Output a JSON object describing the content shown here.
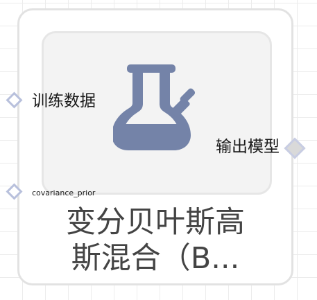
{
  "node": {
    "title_line1": "变分贝叶斯高",
    "title_line2": "斯混合（B...",
    "icon": "flask-icon",
    "inputs": [
      {
        "label": "训练数据"
      },
      {
        "label": "covariance_prior"
      }
    ],
    "outputs": [
      {
        "label": "输出模型"
      }
    ]
  },
  "colors": {
    "icon": "#7483a8",
    "port_border": "#b8c0dc",
    "node_border": "#e2e2e2",
    "icon_bg": "#f3f3f3",
    "title_text": "#444444"
  }
}
